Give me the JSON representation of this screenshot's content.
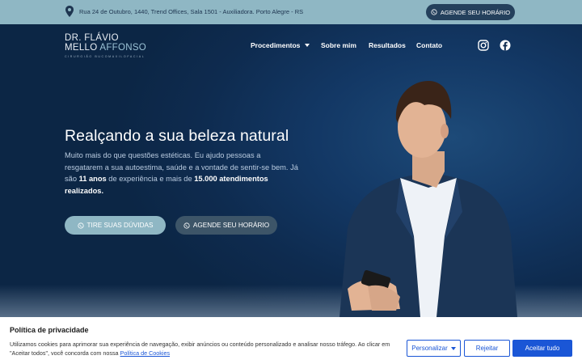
{
  "topbar": {
    "address": "Rua 24 de Outubro, 1440, Trend Offices, Sala 1501 - Auxiliadora. Porto Alegre - RS",
    "cta_label": "AGENDE SEU HORÁRIO",
    "icon_address": "location-pin-icon",
    "icon_cta": "whatsapp-icon"
  },
  "logo": {
    "line1": "DR. FLÁVIO",
    "line2a": "MELLO ",
    "line2b": "AFFONSO",
    "line3": "CIRURGIÃO BUCOMAXILOFACIAL"
  },
  "nav": {
    "items": [
      {
        "label": "Procedimentos",
        "has_dropdown": true
      },
      {
        "label": "Sobre mim"
      },
      {
        "label": "Resultados"
      },
      {
        "label": "Contato"
      }
    ]
  },
  "social": {
    "instagram": "instagram-icon",
    "facebook": "facebook-icon"
  },
  "hero": {
    "title": "Realçando a sua beleza natural",
    "lead_part1": "Muito mais do que questões estéticas. Eu ajudo pessoas a resgatarem a sua autoestima, saúde e a vontade de sentir-se bem. Já são ",
    "lead_bold1": "11 anos",
    "lead_part2": " de experiência e mais de ",
    "lead_bold2": "15.000 atendimentos realizados.",
    "btn_primary": "TIRE SUAS DÚVIDAS",
    "btn_secondary": "AGENDE SEU HORÁRIO"
  },
  "cookie": {
    "title": "Política de privacidade",
    "message": "Utilizamos cookies para aprimorar sua experiência de navegação, exibir anúncios ou conteúdo personalizado e analisar nosso tráfego. Ao clicar em \"Aceitar todos\", você concorda com nossa ",
    "link": "Política de Cookies",
    "btn_customize": "Personalizar",
    "btn_reject": "Rejeitar",
    "btn_accept": "Aceitar tudo"
  },
  "colors": {
    "topbar": "#8fb7c4",
    "hero_bg": "#0e2b4f",
    "accent_blue": "#1a56d6",
    "button_dark": "#3d5568"
  }
}
